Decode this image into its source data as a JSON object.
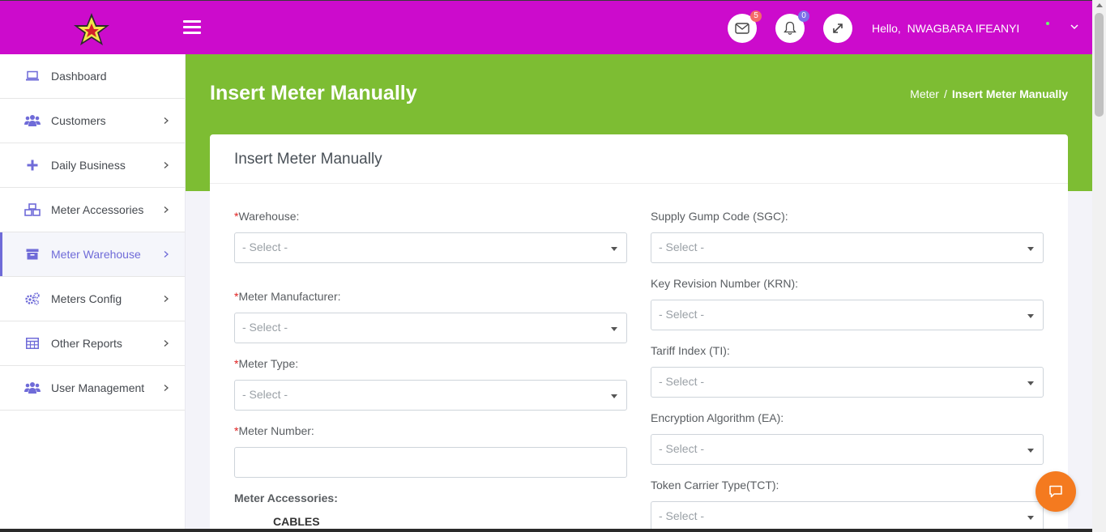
{
  "header": {
    "messages_badge": "5",
    "notifications_badge": "0",
    "greeting": "Hello,  NWAGBARA IFEANYI"
  },
  "sidebar": {
    "items": [
      {
        "label": "Dashboard",
        "icon": "laptop-icon"
      },
      {
        "label": "Customers",
        "icon": "users-icon"
      },
      {
        "label": "Daily Business",
        "icon": "plus-icon"
      },
      {
        "label": "Meter Accessories",
        "icon": "cubes-icon"
      },
      {
        "label": "Meter Warehouse",
        "icon": "archive-icon",
        "active": true
      },
      {
        "label": "Meters Config",
        "icon": "cogs-icon"
      },
      {
        "label": "Other Reports",
        "icon": "table-icon"
      },
      {
        "label": "User Management",
        "icon": "users-icon"
      }
    ]
  },
  "page": {
    "title": "Insert Meter Manually",
    "breadcrumb": {
      "parent": "Meter",
      "separator": "/",
      "current": "Insert Meter Manually"
    }
  },
  "form": {
    "title": "Insert Meter Manually",
    "required_mark": "*",
    "select_placeholder": "- Select -",
    "left": {
      "warehouse_label": "Warehouse:",
      "manufacturer_label": "Meter Manufacturer:",
      "meter_type_label": "Meter Type:",
      "meter_number_label": "Meter Number:",
      "meter_number_value": "",
      "accessories_label": "Meter Accessories:",
      "accessory_item": "CABLES"
    },
    "right": {
      "sgc_label": "Supply Gump Code (SGC):",
      "krn_label": "Key Revision Number (KRN):",
      "ti_label": "Tariff Index (TI):",
      "ea_label": "Encryption Algorithm (EA):",
      "tct_label": "Token Carrier Type(TCT):"
    }
  },
  "colors": {
    "topbar": "#cc0bcc",
    "hero": "#7dbd33",
    "active_nav": "#6f6bd8",
    "chat_button": "#f47a1f"
  }
}
